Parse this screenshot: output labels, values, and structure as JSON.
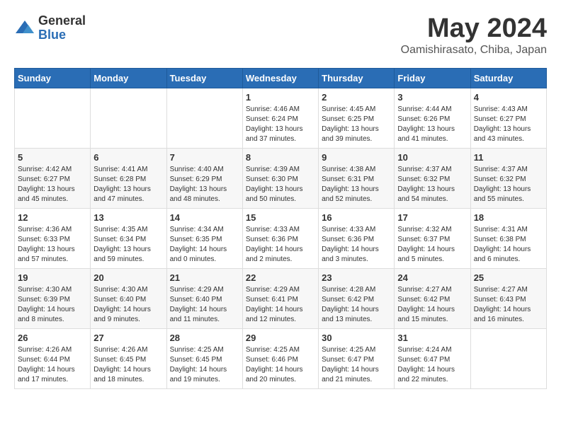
{
  "header": {
    "logo_general": "General",
    "logo_blue": "Blue",
    "month": "May 2024",
    "location": "Oamishirasato, Chiba, Japan"
  },
  "weekdays": [
    "Sunday",
    "Monday",
    "Tuesday",
    "Wednesday",
    "Thursday",
    "Friday",
    "Saturday"
  ],
  "weeks": [
    [
      {
        "day": "",
        "info": ""
      },
      {
        "day": "",
        "info": ""
      },
      {
        "day": "",
        "info": ""
      },
      {
        "day": "1",
        "info": "Sunrise: 4:46 AM\nSunset: 6:24 PM\nDaylight: 13 hours and 37 minutes."
      },
      {
        "day": "2",
        "info": "Sunrise: 4:45 AM\nSunset: 6:25 PM\nDaylight: 13 hours and 39 minutes."
      },
      {
        "day": "3",
        "info": "Sunrise: 4:44 AM\nSunset: 6:26 PM\nDaylight: 13 hours and 41 minutes."
      },
      {
        "day": "4",
        "info": "Sunrise: 4:43 AM\nSunset: 6:27 PM\nDaylight: 13 hours and 43 minutes."
      }
    ],
    [
      {
        "day": "5",
        "info": "Sunrise: 4:42 AM\nSunset: 6:27 PM\nDaylight: 13 hours and 45 minutes."
      },
      {
        "day": "6",
        "info": "Sunrise: 4:41 AM\nSunset: 6:28 PM\nDaylight: 13 hours and 47 minutes."
      },
      {
        "day": "7",
        "info": "Sunrise: 4:40 AM\nSunset: 6:29 PM\nDaylight: 13 hours and 48 minutes."
      },
      {
        "day": "8",
        "info": "Sunrise: 4:39 AM\nSunset: 6:30 PM\nDaylight: 13 hours and 50 minutes."
      },
      {
        "day": "9",
        "info": "Sunrise: 4:38 AM\nSunset: 6:31 PM\nDaylight: 13 hours and 52 minutes."
      },
      {
        "day": "10",
        "info": "Sunrise: 4:37 AM\nSunset: 6:32 PM\nDaylight: 13 hours and 54 minutes."
      },
      {
        "day": "11",
        "info": "Sunrise: 4:37 AM\nSunset: 6:32 PM\nDaylight: 13 hours and 55 minutes."
      }
    ],
    [
      {
        "day": "12",
        "info": "Sunrise: 4:36 AM\nSunset: 6:33 PM\nDaylight: 13 hours and 57 minutes."
      },
      {
        "day": "13",
        "info": "Sunrise: 4:35 AM\nSunset: 6:34 PM\nDaylight: 13 hours and 59 minutes."
      },
      {
        "day": "14",
        "info": "Sunrise: 4:34 AM\nSunset: 6:35 PM\nDaylight: 14 hours and 0 minutes."
      },
      {
        "day": "15",
        "info": "Sunrise: 4:33 AM\nSunset: 6:36 PM\nDaylight: 14 hours and 2 minutes."
      },
      {
        "day": "16",
        "info": "Sunrise: 4:33 AM\nSunset: 6:36 PM\nDaylight: 14 hours and 3 minutes."
      },
      {
        "day": "17",
        "info": "Sunrise: 4:32 AM\nSunset: 6:37 PM\nDaylight: 14 hours and 5 minutes."
      },
      {
        "day": "18",
        "info": "Sunrise: 4:31 AM\nSunset: 6:38 PM\nDaylight: 14 hours and 6 minutes."
      }
    ],
    [
      {
        "day": "19",
        "info": "Sunrise: 4:30 AM\nSunset: 6:39 PM\nDaylight: 14 hours and 8 minutes."
      },
      {
        "day": "20",
        "info": "Sunrise: 4:30 AM\nSunset: 6:40 PM\nDaylight: 14 hours and 9 minutes."
      },
      {
        "day": "21",
        "info": "Sunrise: 4:29 AM\nSunset: 6:40 PM\nDaylight: 14 hours and 11 minutes."
      },
      {
        "day": "22",
        "info": "Sunrise: 4:29 AM\nSunset: 6:41 PM\nDaylight: 14 hours and 12 minutes."
      },
      {
        "day": "23",
        "info": "Sunrise: 4:28 AM\nSunset: 6:42 PM\nDaylight: 14 hours and 13 minutes."
      },
      {
        "day": "24",
        "info": "Sunrise: 4:27 AM\nSunset: 6:42 PM\nDaylight: 14 hours and 15 minutes."
      },
      {
        "day": "25",
        "info": "Sunrise: 4:27 AM\nSunset: 6:43 PM\nDaylight: 14 hours and 16 minutes."
      }
    ],
    [
      {
        "day": "26",
        "info": "Sunrise: 4:26 AM\nSunset: 6:44 PM\nDaylight: 14 hours and 17 minutes."
      },
      {
        "day": "27",
        "info": "Sunrise: 4:26 AM\nSunset: 6:45 PM\nDaylight: 14 hours and 18 minutes."
      },
      {
        "day": "28",
        "info": "Sunrise: 4:25 AM\nSunset: 6:45 PM\nDaylight: 14 hours and 19 minutes."
      },
      {
        "day": "29",
        "info": "Sunrise: 4:25 AM\nSunset: 6:46 PM\nDaylight: 14 hours and 20 minutes."
      },
      {
        "day": "30",
        "info": "Sunrise: 4:25 AM\nSunset: 6:47 PM\nDaylight: 14 hours and 21 minutes."
      },
      {
        "day": "31",
        "info": "Sunrise: 4:24 AM\nSunset: 6:47 PM\nDaylight: 14 hours and 22 minutes."
      },
      {
        "day": "",
        "info": ""
      }
    ]
  ]
}
